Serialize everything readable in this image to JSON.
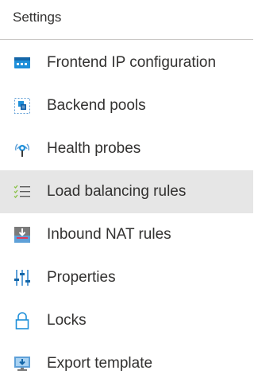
{
  "settings": {
    "header": "Settings",
    "items": [
      {
        "label": "Frontend IP configuration",
        "icon": "frontend-ip-icon",
        "selected": false
      },
      {
        "label": "Backend pools",
        "icon": "backend-pool-icon",
        "selected": false
      },
      {
        "label": "Health probes",
        "icon": "health-probe-icon",
        "selected": false
      },
      {
        "label": "Load balancing rules",
        "icon": "rules-list-icon",
        "selected": true
      },
      {
        "label": "Inbound NAT rules",
        "icon": "inbound-nat-icon",
        "selected": false
      },
      {
        "label": "Properties",
        "icon": "properties-sliders-icon",
        "selected": false
      },
      {
        "label": "Locks",
        "icon": "lock-icon",
        "selected": false
      },
      {
        "label": "Export template",
        "icon": "export-template-icon",
        "selected": false
      }
    ]
  },
  "colors": {
    "accent": "#0078d4",
    "selected_background": "#e6e6e6",
    "text": "#323130",
    "divider": "#c8c6c4"
  }
}
